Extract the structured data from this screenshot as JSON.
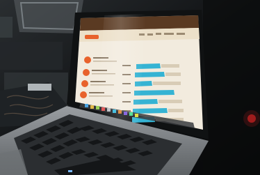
{
  "colors": {
    "background": "#0d0f10",
    "screen_page": "#f2ebde",
    "accent_orange": "#e8622c",
    "bar_cyan": "#35b3d3",
    "laptop_body": "#8d9194",
    "keys": "#1a1c1e",
    "dock": "#3a3c40"
  }
}
